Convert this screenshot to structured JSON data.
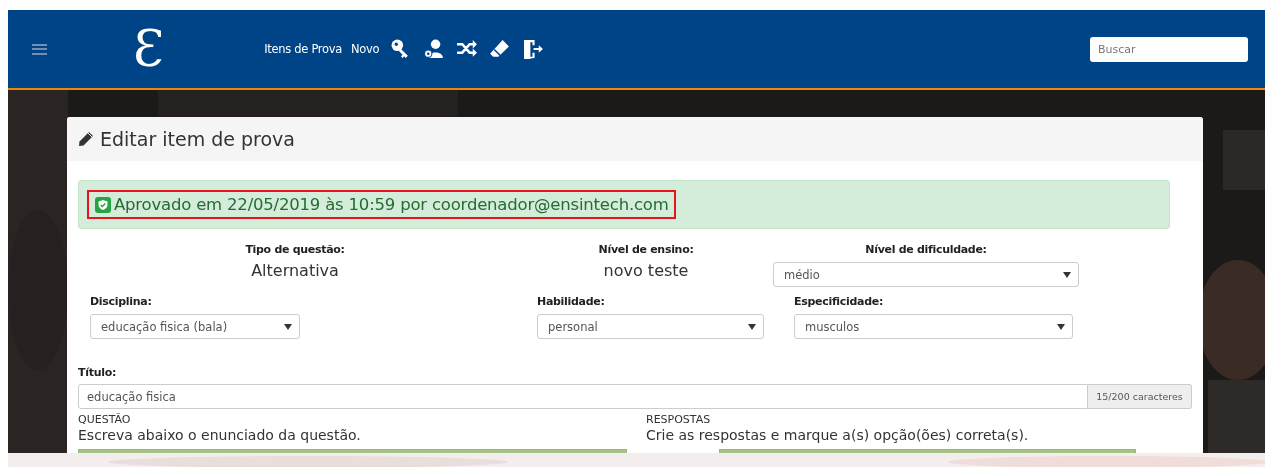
{
  "navbar": {
    "logo": "Ɛ",
    "links": [
      "Itens de Prova",
      "Novo"
    ],
    "icon_buttons": [
      {
        "kind": "key"
      },
      {
        "kind": "user-gear"
      },
      {
        "kind": "shuffle"
      },
      {
        "kind": "eraser"
      },
      {
        "kind": "exit"
      }
    ],
    "search": {
      "placeholder": "Buscar"
    }
  },
  "card": {
    "title": "Editar item de prova",
    "alert": {
      "text": "Aprovado em 22/05/2019 às 10:59 por coordenador@ensintech.com",
      "highlighted": true
    },
    "info": [
      {
        "label": "Tipo de questão:",
        "value": "Alternativa"
      },
      {
        "label": "Nível de ensino:",
        "value": "novo teste"
      }
    ],
    "difficulty": {
      "label": "Nível de dificuldade:",
      "value": "médio"
    },
    "selects": [
      {
        "label": "Disciplina:",
        "value": "educação fisica (bala)"
      },
      {
        "label": "Habilidade:",
        "value": "personal"
      },
      {
        "label": "Especificidade:",
        "value": "musculos"
      }
    ],
    "title_field": {
      "label": "Título:",
      "value": "educação fisica",
      "counter": "15/200 caracteres"
    },
    "sections": [
      {
        "heading": "QUESTÃO",
        "hint": "Escreva abaixo o enunciado da questão."
      },
      {
        "heading": "RESPOSTAS",
        "hint": "Crie as respostas e marque a(s) opção(ões) correta(s)."
      }
    ]
  }
}
